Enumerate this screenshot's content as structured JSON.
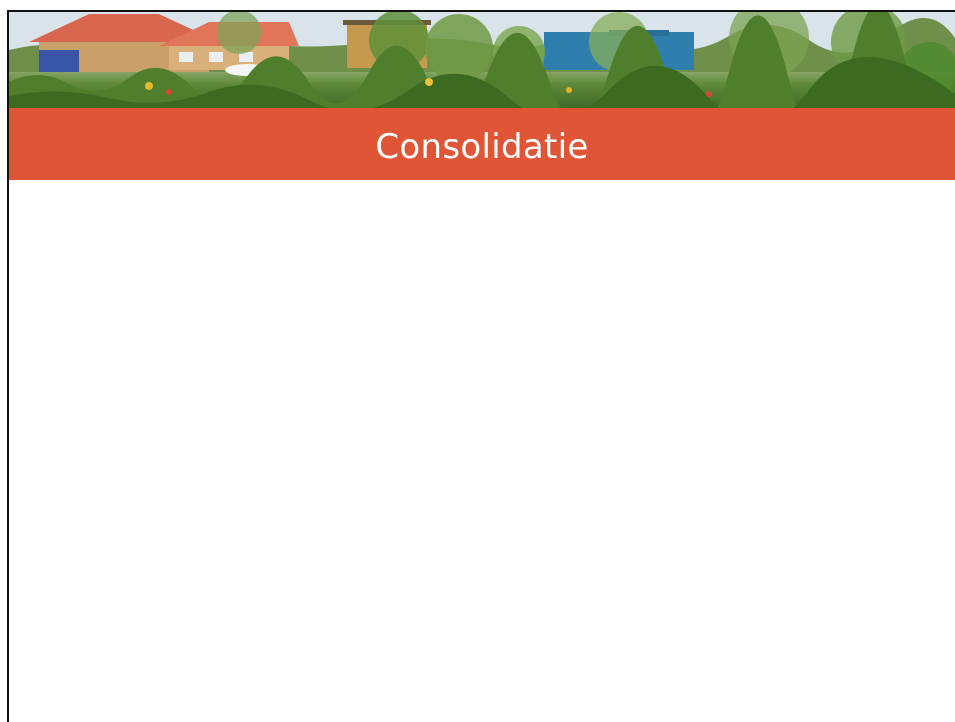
{
  "slide": {
    "title": "Consolidatie",
    "title_bar_color": "#df5535",
    "banner_image": "photo-of-green-neighborhood-with-houses-and-trees"
  }
}
